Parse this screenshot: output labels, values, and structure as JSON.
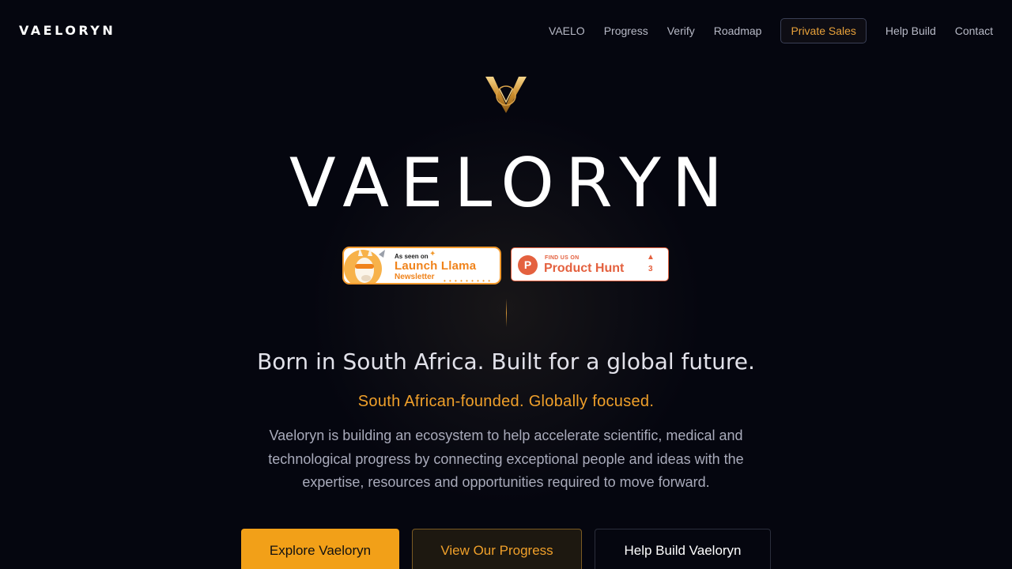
{
  "header": {
    "brand": "VAELORYN",
    "nav": [
      "VAELO",
      "Progress",
      "Verify",
      "Roadmap",
      "Private Sales",
      "Help Build",
      "Contact"
    ]
  },
  "hero": {
    "title": "VAELORYN",
    "badges": {
      "launch_llama": {
        "seen": "As seen on",
        "name": "Launch Llama",
        "sub": "Newsletter"
      },
      "product_hunt": {
        "find": "FIND US ON",
        "name": "Product Hunt",
        "logo_letter": "P",
        "count": "3"
      }
    },
    "tagline": "Born in South Africa. Built for a global future.",
    "subtagline": "South African-founded. Globally focused.",
    "description": "Vaeloryn is building an ecosystem to help accelerate scientific, medical and technological progress by connecting exceptional people and ideas with the expertise, resources and opportunities required to move forward.",
    "buttons": {
      "primary": "Explore Vaeloryn",
      "secondary": "View Our Progress",
      "tertiary": "Help Build Vaeloryn"
    }
  },
  "colors": {
    "background": "#05060f",
    "accent": "#f2a018",
    "product_hunt": "#e4613f"
  },
  "icons": {
    "logo": "vaeloryn-v-logo",
    "launch_llama": "llama-mascot-icon",
    "product_hunt": "product-hunt-logo",
    "upvote": "upvote-triangle-icon"
  }
}
